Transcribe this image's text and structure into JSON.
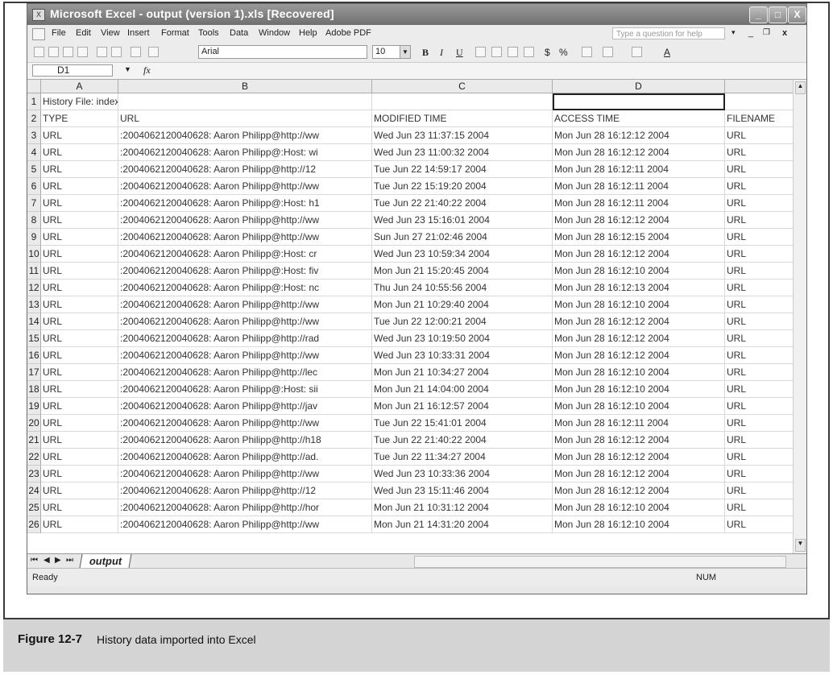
{
  "window": {
    "title": "Microsoft Excel - output (version 1).xls [Recovered]",
    "controls": {
      "minimize": "_",
      "restore": "□",
      "close": "X"
    }
  },
  "menubar": {
    "items": [
      "File",
      "Edit",
      "View",
      "Insert",
      "Format",
      "Tools",
      "Data",
      "Window",
      "Help",
      "Adobe PDF"
    ],
    "help_placeholder": "Type a question for help"
  },
  "toolbar": {
    "font": "Arial",
    "size": "10",
    "bold": "B",
    "italic": "I",
    "underline": "U",
    "currency": "$",
    "percent": "%"
  },
  "formula_bar": {
    "name_box": "D1",
    "fx": "fx",
    "value": ""
  },
  "sheet": {
    "columns": [
      "A",
      "B",
      "C",
      "D"
    ],
    "rows": [
      {
        "num": "1",
        "a": "History File: index.dat",
        "b": "",
        "c": "",
        "d": "",
        "e": ""
      },
      {
        "num": "2",
        "a": "TYPE",
        "b": "URL",
        "c": "MODIFIED TIME",
        "d": "ACCESS TIME",
        "e": "FILENAME"
      },
      {
        "num": "3",
        "a": "URL",
        "b": ":2004062120040628: Aaron Philipp@http://ww",
        "c": "Wed Jun 23 11:37:15 2004",
        "d": "Mon Jun 28 16:12:12 2004",
        "e": "URL"
      },
      {
        "num": "4",
        "a": "URL",
        "b": ":2004062120040628: Aaron Philipp@:Host: wi",
        "c": "Wed Jun 23 11:00:32 2004",
        "d": "Mon Jun 28 16:12:12 2004",
        "e": "URL"
      },
      {
        "num": "5",
        "a": "URL",
        "b": ":2004062120040628: Aaron Philipp@http://12",
        "c": "Tue Jun 22 14:59:17 2004",
        "d": "Mon Jun 28 16:12:11 2004",
        "e": "URL"
      },
      {
        "num": "6",
        "a": "URL",
        "b": ":2004062120040628: Aaron Philipp@http://ww",
        "c": "Tue Jun 22 15:19:20 2004",
        "d": "Mon Jun 28 16:12:11 2004",
        "e": "URL"
      },
      {
        "num": "7",
        "a": "URL",
        "b": ":2004062120040628: Aaron Philipp@:Host: h1",
        "c": "Tue Jun 22 21:40:22 2004",
        "d": "Mon Jun 28 16:12:11 2004",
        "e": "URL"
      },
      {
        "num": "8",
        "a": "URL",
        "b": ":2004062120040628: Aaron Philipp@http://ww",
        "c": "Wed Jun 23 15:16:01 2004",
        "d": "Mon Jun 28 16:12:12 2004",
        "e": "URL"
      },
      {
        "num": "9",
        "a": "URL",
        "b": ":2004062120040628: Aaron Philipp@http://ww",
        "c": "Sun Jun 27 21:02:46 2004",
        "d": "Mon Jun 28 16:12:15 2004",
        "e": "URL"
      },
      {
        "num": "10",
        "a": "URL",
        "b": ":2004062120040628: Aaron Philipp@:Host: cr",
        "c": "Wed Jun 23 10:59:34 2004",
        "d": "Mon Jun 28 16:12:12 2004",
        "e": "URL"
      },
      {
        "num": "11",
        "a": "URL",
        "b": ":2004062120040628: Aaron Philipp@:Host: fiv",
        "c": "Mon Jun 21 15:20:45 2004",
        "d": "Mon Jun 28 16:12:10 2004",
        "e": "URL"
      },
      {
        "num": "12",
        "a": "URL",
        "b": ":2004062120040628: Aaron Philipp@:Host: nc",
        "c": "Thu Jun 24 10:55:56 2004",
        "d": "Mon Jun 28 16:12:13 2004",
        "e": "URL"
      },
      {
        "num": "13",
        "a": "URL",
        "b": ":2004062120040628: Aaron Philipp@http://ww",
        "c": "Mon Jun 21 10:29:40 2004",
        "d": "Mon Jun 28 16:12:10 2004",
        "e": "URL"
      },
      {
        "num": "14",
        "a": "URL",
        "b": ":2004062120040628: Aaron Philipp@http://ww",
        "c": "Tue Jun 22 12:00:21 2004",
        "d": "Mon Jun 28 16:12:12 2004",
        "e": "URL"
      },
      {
        "num": "15",
        "a": "URL",
        "b": ":2004062120040628: Aaron Philipp@http://rad",
        "c": "Wed Jun 23 10:19:50 2004",
        "d": "Mon Jun 28 16:12:12 2004",
        "e": "URL"
      },
      {
        "num": "16",
        "a": "URL",
        "b": ":2004062120040628: Aaron Philipp@http://ww",
        "c": "Wed Jun 23 10:33:31 2004",
        "d": "Mon Jun 28 16:12:12 2004",
        "e": "URL"
      },
      {
        "num": "17",
        "a": "URL",
        "b": ":2004062120040628: Aaron Philipp@http://lec",
        "c": "Mon Jun 21 10:34:27 2004",
        "d": "Mon Jun 28 16:12:10 2004",
        "e": "URL"
      },
      {
        "num": "18",
        "a": "URL",
        "b": ":2004062120040628: Aaron Philipp@:Host: sii",
        "c": "Mon Jun 21 14:04:00 2004",
        "d": "Mon Jun 28 16:12:10 2004",
        "e": "URL"
      },
      {
        "num": "19",
        "a": "URL",
        "b": ":2004062120040628: Aaron Philipp@http://jav",
        "c": "Mon Jun 21 16:12:57 2004",
        "d": "Mon Jun 28 16:12:10 2004",
        "e": "URL"
      },
      {
        "num": "20",
        "a": "URL",
        "b": ":2004062120040628: Aaron Philipp@http://ww",
        "c": "Tue Jun 22 15:41:01 2004",
        "d": "Mon Jun 28 16:12:11 2004",
        "e": "URL"
      },
      {
        "num": "21",
        "a": "URL",
        "b": ":2004062120040628: Aaron Philipp@http://h18",
        "c": "Tue Jun 22 21:40:22 2004",
        "d": "Mon Jun 28 16:12:12 2004",
        "e": "URL"
      },
      {
        "num": "22",
        "a": "URL",
        "b": ":2004062120040628: Aaron Philipp@http://ad.",
        "c": "Tue Jun 22 11:34:27 2004",
        "d": "Mon Jun 28 16:12:12 2004",
        "e": "URL"
      },
      {
        "num": "23",
        "a": "URL",
        "b": ":2004062120040628: Aaron Philipp@http://ww",
        "c": "Wed Jun 23 10:33:36 2004",
        "d": "Mon Jun 28 16:12:12 2004",
        "e": "URL"
      },
      {
        "num": "24",
        "a": "URL",
        "b": ":2004062120040628: Aaron Philipp@http://12",
        "c": "Wed Jun 23 15:11:46 2004",
        "d": "Mon Jun 28 16:12:12 2004",
        "e": "URL"
      },
      {
        "num": "25",
        "a": "URL",
        "b": ":2004062120040628: Aaron Philipp@http://hor",
        "c": "Mon Jun 21 10:31:12 2004",
        "d": "Mon Jun 28 16:12:10 2004",
        "e": "URL"
      },
      {
        "num": "26",
        "a": "URL",
        "b": ":2004062120040628: Aaron Philipp@http://ww",
        "c": "Mon Jun 21 14:31:20 2004",
        "d": "Mon Jun 28 16:12:10 2004",
        "e": "URL"
      }
    ]
  },
  "sheet_tabs": {
    "active": "output"
  },
  "status": {
    "left": "Ready",
    "num": "NUM"
  },
  "caption": {
    "label": "Figure 12-7",
    "text": "History data imported into Excel"
  },
  "colors": {
    "titlebar": "#7f7f7f",
    "caption_bg": "#d4d4d4"
  }
}
